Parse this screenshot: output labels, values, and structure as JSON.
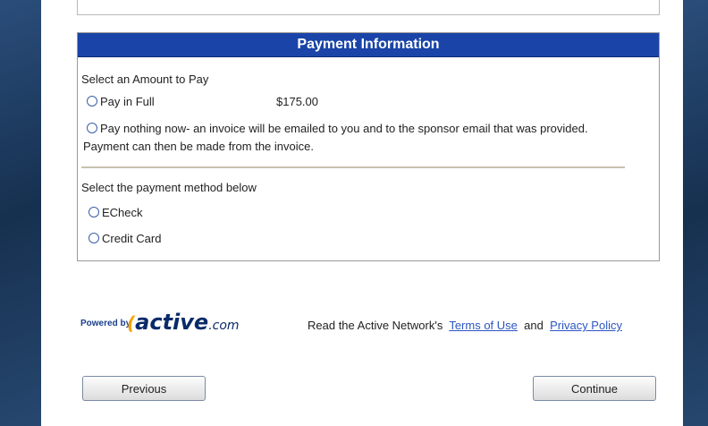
{
  "payment": {
    "header": "Payment Information",
    "amount_label": "Select an Amount to Pay",
    "options": [
      {
        "label": "Pay in Full",
        "amount": "$175.00"
      },
      {
        "label": "Pay nothing now- an invoice will be emailed to you and to the sponsor email that was provided.",
        "label_line2": "Payment can then be made from the invoice."
      }
    ],
    "method_label": "Select the payment method below",
    "methods": [
      "ECheck",
      "Credit Card"
    ]
  },
  "footer": {
    "powered_by": "Powered by",
    "logo_main": "active",
    "logo_suffix": ".com",
    "read_text": "Read the Active Network's",
    "terms": "Terms of Use",
    "and": "and",
    "privacy": "Privacy Policy"
  },
  "buttons": {
    "previous": "Previous",
    "continue": "Continue"
  },
  "colors": {
    "header_bg": "#1a44a8",
    "link": "#2b55c2",
    "page_bg": "#1d3557"
  }
}
